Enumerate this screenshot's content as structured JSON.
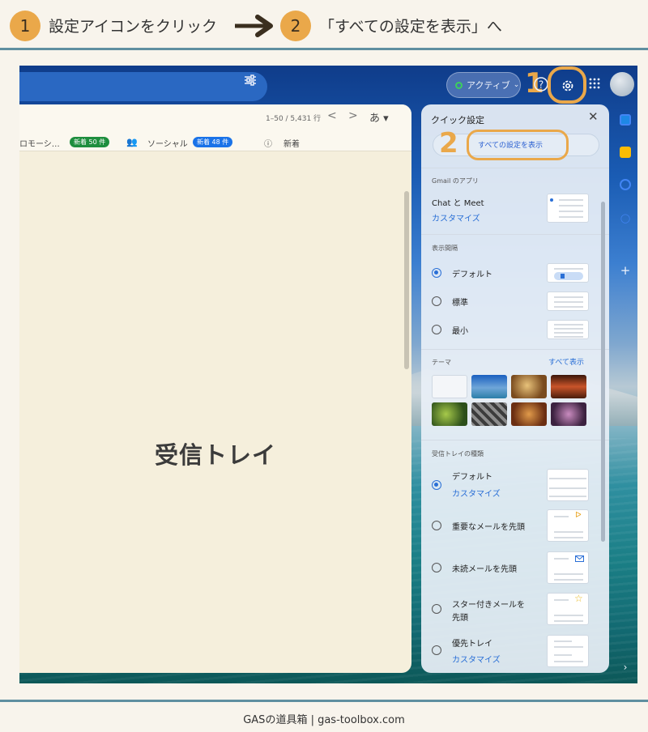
{
  "instruction": {
    "step1_number": "1",
    "step1_text": "設定アイコンをクリック",
    "step2_number": "2",
    "step2_text": "「すべての設定を表示」へ"
  },
  "gmail": {
    "status_label": "アクティブ",
    "annotation_1": "1",
    "annotation_2": "2",
    "inbox": {
      "pager": "1–50 / 5,431 行",
      "prev": "<",
      "next": ">",
      "sort": "あ ▾",
      "tabs": [
        {
          "label": "ロモーシ…",
          "badge": "新着 50 件",
          "badge_color": "#1e8e3e"
        },
        {
          "label": "ソーシャル",
          "badge": "新着 48 件",
          "badge_color": "#1a73e8"
        },
        {
          "label": "新着",
          "badge": "",
          "badge_color": ""
        }
      ],
      "title": "受信トレイ"
    },
    "quick_settings": {
      "title": "クイック設定",
      "close": "✕",
      "all_settings": "すべての設定を表示",
      "apps_section": "Gmail のアプリ",
      "chat_meet": "Chat と Meet",
      "customize": "カスタマイズ",
      "density_section": "表示間隔",
      "density_options": [
        {
          "label": "デフォルト",
          "selected": true
        },
        {
          "label": "標準",
          "selected": false
        },
        {
          "label": "最小",
          "selected": false
        }
      ],
      "theme_section": "テーマ",
      "theme_show_all": "すべて表示",
      "inbox_type_section": "受信トレイの種類",
      "inbox_types": [
        {
          "label": "デフォルト",
          "sub": "カスタマイズ",
          "selected": true,
          "badge_icon": ""
        },
        {
          "label": "重要なメールを先頭",
          "sub": "",
          "selected": false,
          "badge_icon": "important-icon"
        },
        {
          "label": "未読メールを先頭",
          "sub": "",
          "selected": false,
          "badge_icon": "envelope-icon"
        },
        {
          "label": "スター付きメールを",
          "sub2": "先頭",
          "sub": "",
          "selected": false,
          "badge_icon": "star-icon"
        },
        {
          "label": "優先トレイ",
          "sub": "カスタマイズ",
          "selected": false,
          "badge_icon": ""
        }
      ]
    }
  },
  "footer": "GASの道具箱 | gas-toolbox.com",
  "colors": {
    "accent_orange": "#eaa84a",
    "frame_blue": "#5f8fa0",
    "link_blue": "#2a6fd6"
  }
}
